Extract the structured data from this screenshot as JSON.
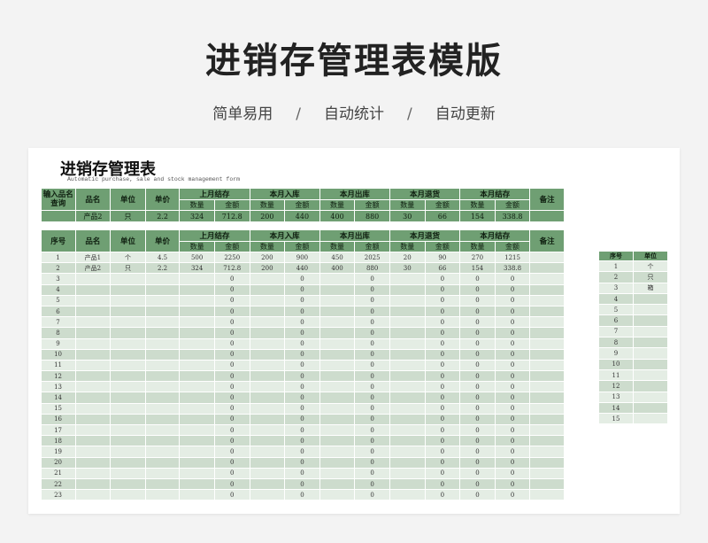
{
  "page": {
    "title": "进销存管理表模版",
    "features": [
      "简单易用",
      "自动统计",
      "自动更新"
    ],
    "separator": "/"
  },
  "sheet": {
    "title": "进销存管理表",
    "subtitle": "Automatic purchase, sale and stock management form"
  },
  "colors": {
    "header_green": "#6f9f73",
    "row_light": "#e4ede4",
    "row_dark": "#cddccd"
  },
  "summary": {
    "labels": {
      "query": "输入品名查询",
      "name": "品名",
      "unit": "单位",
      "price": "单价",
      "remark": "备注",
      "qty": "数量",
      "amt": "金额",
      "groups": [
        "上月结存",
        "本月入库",
        "本月出库",
        "本月退货",
        "本月结存"
      ]
    },
    "row": [
      "产品2",
      "只",
      "2.2",
      "324",
      "712.8",
      "200",
      "440",
      "400",
      "880",
      "30",
      "66",
      "154",
      "338.8",
      ""
    ]
  },
  "main": {
    "labels": {
      "seq": "序号",
      "name": "品名",
      "unit": "单位",
      "price": "单价",
      "remark": "备注"
    },
    "rows": [
      [
        "1",
        "产品1",
        "个",
        "4.5",
        "500",
        "2250",
        "200",
        "900",
        "450",
        "2025",
        "20",
        "90",
        "270",
        "1215",
        ""
      ],
      [
        "2",
        "产品2",
        "只",
        "2.2",
        "324",
        "712.8",
        "200",
        "440",
        "400",
        "880",
        "30",
        "66",
        "154",
        "338.8",
        ""
      ],
      [
        "3",
        "",
        "",
        "",
        "",
        "0",
        "",
        "0",
        "",
        "0",
        "",
        "0",
        "0",
        "0",
        ""
      ],
      [
        "4",
        "",
        "",
        "",
        "",
        "0",
        "",
        "0",
        "",
        "0",
        "",
        "0",
        "0",
        "0",
        ""
      ],
      [
        "5",
        "",
        "",
        "",
        "",
        "0",
        "",
        "0",
        "",
        "0",
        "",
        "0",
        "0",
        "0",
        ""
      ],
      [
        "6",
        "",
        "",
        "",
        "",
        "0",
        "",
        "0",
        "",
        "0",
        "",
        "0",
        "0",
        "0",
        ""
      ],
      [
        "7",
        "",
        "",
        "",
        "",
        "0",
        "",
        "0",
        "",
        "0",
        "",
        "0",
        "0",
        "0",
        ""
      ],
      [
        "8",
        "",
        "",
        "",
        "",
        "0",
        "",
        "0",
        "",
        "0",
        "",
        "0",
        "0",
        "0",
        ""
      ],
      [
        "9",
        "",
        "",
        "",
        "",
        "0",
        "",
        "0",
        "",
        "0",
        "",
        "0",
        "0",
        "0",
        ""
      ],
      [
        "10",
        "",
        "",
        "",
        "",
        "0",
        "",
        "0",
        "",
        "0",
        "",
        "0",
        "0",
        "0",
        ""
      ],
      [
        "11",
        "",
        "",
        "",
        "",
        "0",
        "",
        "0",
        "",
        "0",
        "",
        "0",
        "0",
        "0",
        ""
      ],
      [
        "12",
        "",
        "",
        "",
        "",
        "0",
        "",
        "0",
        "",
        "0",
        "",
        "0",
        "0",
        "0",
        ""
      ],
      [
        "13",
        "",
        "",
        "",
        "",
        "0",
        "",
        "0",
        "",
        "0",
        "",
        "0",
        "0",
        "0",
        ""
      ],
      [
        "14",
        "",
        "",
        "",
        "",
        "0",
        "",
        "0",
        "",
        "0",
        "",
        "0",
        "0",
        "0",
        ""
      ],
      [
        "15",
        "",
        "",
        "",
        "",
        "0",
        "",
        "0",
        "",
        "0",
        "",
        "0",
        "0",
        "0",
        ""
      ],
      [
        "16",
        "",
        "",
        "",
        "",
        "0",
        "",
        "0",
        "",
        "0",
        "",
        "0",
        "0",
        "0",
        ""
      ],
      [
        "17",
        "",
        "",
        "",
        "",
        "0",
        "",
        "0",
        "",
        "0",
        "",
        "0",
        "0",
        "0",
        ""
      ],
      [
        "18",
        "",
        "",
        "",
        "",
        "0",
        "",
        "0",
        "",
        "0",
        "",
        "0",
        "0",
        "0",
        ""
      ],
      [
        "19",
        "",
        "",
        "",
        "",
        "0",
        "",
        "0",
        "",
        "0",
        "",
        "0",
        "0",
        "0",
        ""
      ],
      [
        "20",
        "",
        "",
        "",
        "",
        "0",
        "",
        "0",
        "",
        "0",
        "",
        "0",
        "0",
        "0",
        ""
      ],
      [
        "21",
        "",
        "",
        "",
        "",
        "0",
        "",
        "0",
        "",
        "0",
        "",
        "0",
        "0",
        "0",
        ""
      ],
      [
        "22",
        "",
        "",
        "",
        "",
        "0",
        "",
        "0",
        "",
        "0",
        "",
        "0",
        "0",
        "0",
        ""
      ],
      [
        "23",
        "",
        "",
        "",
        "",
        "0",
        "",
        "0",
        "",
        "0",
        "",
        "0",
        "0",
        "0",
        ""
      ]
    ]
  },
  "lookup": {
    "headers": [
      "序号",
      "单位"
    ],
    "rows": [
      [
        "1",
        "个"
      ],
      [
        "2",
        "只"
      ],
      [
        "3",
        "箱"
      ],
      [
        "4",
        ""
      ],
      [
        "5",
        ""
      ],
      [
        "6",
        ""
      ],
      [
        "7",
        ""
      ],
      [
        "8",
        ""
      ],
      [
        "9",
        ""
      ],
      [
        "10",
        ""
      ],
      [
        "11",
        ""
      ],
      [
        "12",
        ""
      ],
      [
        "13",
        ""
      ],
      [
        "14",
        ""
      ],
      [
        "15",
        ""
      ]
    ]
  }
}
